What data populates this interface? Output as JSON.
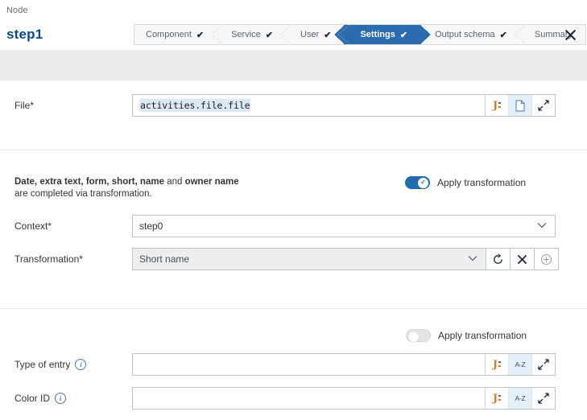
{
  "header": {
    "breadcrumb": "Node",
    "title": "step1",
    "close_icon": "close-icon"
  },
  "wizard": {
    "steps": [
      {
        "label": "Component",
        "done": true,
        "active": false
      },
      {
        "label": "Service",
        "done": true,
        "active": false
      },
      {
        "label": "User",
        "done": true,
        "active": false
      },
      {
        "label": "Settings",
        "done": true,
        "active": true
      },
      {
        "label": "Output schema",
        "done": true,
        "active": false
      },
      {
        "label": "Summary",
        "done": false,
        "active": false
      }
    ],
    "check_glyph": "✔",
    "active_color": "#2b6caf"
  },
  "form": {
    "file": {
      "label": "File*",
      "value": "activities.file.file",
      "placeholder": "",
      "buttons": [
        "json-expression-icon",
        "file-browse-icon",
        "expand-icon"
      ]
    },
    "transformation_section": {
      "note_bold": "Date, extra text, form, short, name",
      "note_and": "and",
      "note_bold2": "owner name",
      "note_rest": "are completed via transformation.",
      "toggle_label": "Apply transformation",
      "toggle_on": true,
      "context": {
        "label": "Context*",
        "value": "step0"
      },
      "transformation": {
        "label": "Transformation*",
        "value": "Short name",
        "buttons": [
          "refresh-icon",
          "clear-icon",
          "add-icon"
        ]
      }
    },
    "entry_section": {
      "toggle_label": "Apply transformation",
      "toggle_on": false,
      "type_of_entry": {
        "label": "Type of entry",
        "value": "",
        "placeholder": "",
        "buttons": [
          "json-expression-icon",
          "text-az-icon",
          "expand-icon"
        ]
      },
      "color_id": {
        "label": "Color ID",
        "value": "",
        "placeholder": "",
        "buttons": [
          "json-expression-icon",
          "text-az-icon",
          "expand-icon"
        ]
      }
    }
  }
}
